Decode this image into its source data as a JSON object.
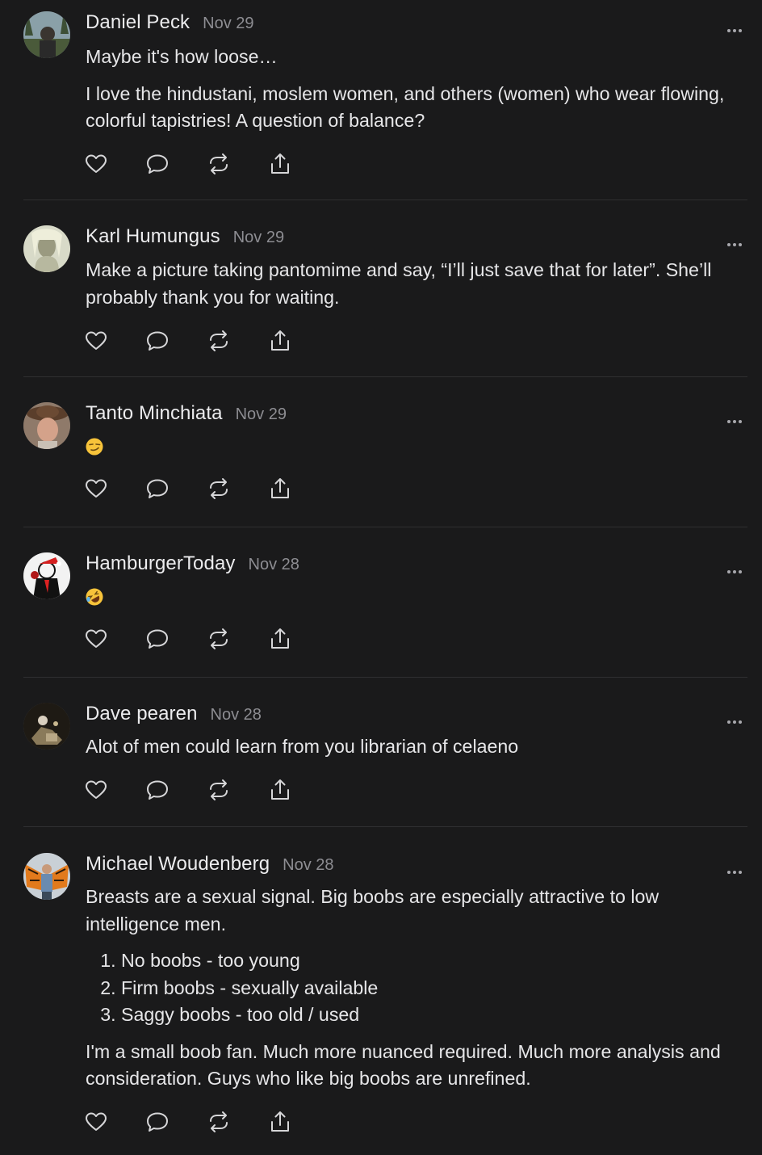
{
  "comments": [
    {
      "author": "Daniel Peck",
      "date": "Nov 29",
      "paragraphs": [
        "Maybe it's how loose…",
        "I love the hindustani, moslem women, and others (women) who wear flowing, colorful tapistries! A question of balance?"
      ]
    },
    {
      "author": "Karl Humungus",
      "date": "Nov 29",
      "paragraphs": [
        "Make a picture taking pantomime and say, “I’ll just save that for later”. She’ll probably thank you for waiting."
      ]
    },
    {
      "author": "Tanto Minchiata",
      "date": "Nov 29",
      "emoji": "smirking-face"
    },
    {
      "author": "HamburgerToday",
      "date": "Nov 28",
      "emoji": "rolling-on-floor-laughing-face"
    },
    {
      "author": "Dave pearen",
      "date": "Nov 28",
      "paragraphs": [
        "Alot of men could learn from you librarian of celaeno"
      ]
    },
    {
      "author": "Michael Woudenberg",
      "date": "Nov 28",
      "paragraphs": [
        "Breasts are a sexual signal. Big boobs are especially attractive to low intelligence men."
      ],
      "list": [
        "No boobs - too young",
        "Firm boobs - sexually available",
        "Saggy boobs - too old / used"
      ],
      "after": [
        "I'm a small boob fan. Much more nuanced required. Much more analysis and consideration. Guys who like big boobs are unrefined."
      ]
    }
  ],
  "actions": {
    "icons": [
      "heart-icon",
      "reply-icon",
      "restack-icon",
      "share-icon"
    ]
  },
  "colors": {
    "background": "#1a1a1b",
    "text": "#e9e9ea",
    "muted": "#8d8d92",
    "divider": "#2f2f31",
    "icon": "#d6d6d8"
  }
}
